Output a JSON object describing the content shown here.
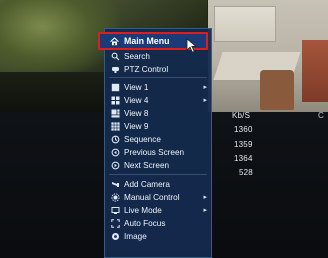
{
  "menu": {
    "main_menu": "Main Menu",
    "items": [
      {
        "label": "Search",
        "icon": "search-icon",
        "has_submenu": false
      },
      {
        "label": "PTZ Control",
        "icon": "ptz-icon",
        "has_submenu": false
      },
      {
        "label": "View 1",
        "icon": "view1-icon",
        "has_submenu": true
      },
      {
        "label": "View 4",
        "icon": "view4-icon",
        "has_submenu": true
      },
      {
        "label": "View 8",
        "icon": "view8-icon",
        "has_submenu": false
      },
      {
        "label": "View 9",
        "icon": "view9-icon",
        "has_submenu": false
      },
      {
        "label": "Sequence",
        "icon": "sequence-icon",
        "has_submenu": false
      },
      {
        "label": "Previous Screen",
        "icon": "previous-screen-icon",
        "has_submenu": false
      },
      {
        "label": "Next Screen",
        "icon": "next-screen-icon",
        "has_submenu": false
      },
      {
        "label": "Add Camera",
        "icon": "add-camera-icon",
        "has_submenu": false
      },
      {
        "label": "Manual Control",
        "icon": "manual-control-icon",
        "has_submenu": true
      },
      {
        "label": "Live Mode",
        "icon": "live-mode-icon",
        "has_submenu": true
      },
      {
        "label": "Auto Focus",
        "icon": "auto-focus-icon",
        "has_submenu": false
      },
      {
        "label": "Image",
        "icon": "image-icon",
        "has_submenu": false
      }
    ]
  },
  "stats": {
    "header": "Kb/S",
    "header_partial": "C",
    "values": [
      "1360",
      "1359",
      "1364",
      "528"
    ]
  },
  "colors": {
    "menu_bg": "#142a4e",
    "highlight_border": "#e01d1d",
    "highlight_bg": "#1a3b78"
  }
}
